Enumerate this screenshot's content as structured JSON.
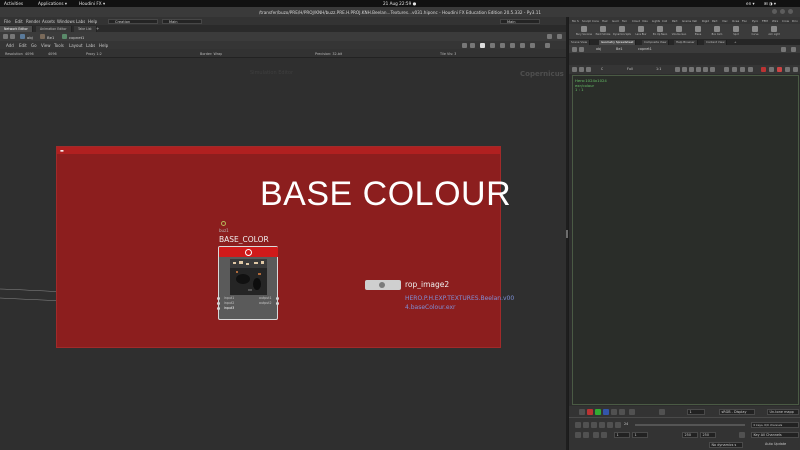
{
  "os_bar": {
    "activities": "Activities",
    "applications": "Applications ▾",
    "app_name": "Houdini FX ▾",
    "clock": "21 Aug  22:59 ●",
    "language": "en ▾",
    "system_icons": "⊞ ◑ ▾"
  },
  "window": {
    "title": "/transfer/buzo/PRE/H/PROJ/KNH/buzz.PRE.H.PROJ.KNH.Beelan...Textures...v031.hiponc - Houdini FX Education Edition 20.5.332 - Py3.11"
  },
  "menubar": {
    "items": [
      "File",
      "Edit",
      "Render",
      "Assets",
      "Windows",
      "Labs",
      "Help"
    ],
    "desktop": "Creation",
    "desktop2": "Main",
    "desktop3": "Main"
  },
  "left_tabs": [
    {
      "label": "Network Editor",
      "active": true
    },
    {
      "label": "Animation Editor",
      "active": false
    },
    {
      "label": "Take List",
      "active": false
    }
  ],
  "left_path": {
    "context": "obj",
    "node": "Be1",
    "copnet": "copnet1"
  },
  "network_menu": [
    "Add",
    "Edit",
    "Go",
    "View",
    "Tools",
    "Layout",
    "Labs",
    "Help"
  ],
  "param_row": {
    "resolution_label": "Resolution",
    "resolution_x": "4096",
    "resolution_y": "4096",
    "proxy": "Proxy 1:2",
    "border": "Border: Wrap",
    "precision": "Precision: 32-bit",
    "tile": "Tile Vis: 3"
  },
  "network": {
    "label": "Simulation Editor",
    "context_label": "Copernicus",
    "netbox_title": "BASE COLOUR",
    "node": {
      "path_label": "buz1",
      "name": "BASE_COLOR",
      "inputs": [
        "input1",
        "input2",
        "input3"
      ],
      "outputs": [
        "output1",
        "output2"
      ]
    },
    "rop": {
      "name": "rop_image2",
      "file": "HERO.P.H.EXP.TEXTURES.Beelan.v004.baseColour.exr"
    }
  },
  "right_pane": {
    "shelf_tabs": [
      "Mo S",
      "Sculpt",
      "Cons",
      "Hair",
      "Guid",
      "Terr",
      "Cloud",
      "Volu",
      "Lights",
      "Coll",
      "Part",
      "Grains",
      "Vell",
      "Rigid",
      "Part",
      "Visc",
      "Ocea",
      "Flui",
      "Pyro",
      "FEM",
      "Wire",
      "Crow",
      "Driv"
    ],
    "shelf_tools": [
      "Bury Sonoine",
      "Paint Smoke",
      "Dynamics Sphere",
      "Lens Blur",
      "Pin Up Neon",
      "Volume Gen",
      "Plane",
      "Box Cam",
      "Spot",
      "Curve",
      "Aim Light"
    ],
    "view_tabs": [
      {
        "label": "Scene View",
        "active": false
      },
      {
        "label": "Geometry Spreadsheet",
        "active": true
      },
      {
        "label": "Composite View",
        "active": false
      },
      {
        "label": "Help Browser",
        "active": false
      },
      {
        "label": "Context View",
        "active": false
      }
    ],
    "path": {
      "context": "obj",
      "node": "Be1",
      "copnet": "copnet1"
    },
    "viewer_toolbar": {
      "mode": "C",
      "zoom": "Full",
      "aspect": "1:1"
    },
    "viewport_info": [
      "Hero:1024x1024",
      "exr/colour",
      "1 : 1"
    ],
    "timebar": {
      "frame": "1",
      "start": "1",
      "end": "250",
      "end2": "250",
      "fps": "24",
      "display": "sRGB - Display",
      "tone": "Un-tone mapp",
      "keys_label": "0 keys, 0/0 channels",
      "key_all": "Key All Channels",
      "dynamics": "No dynamics s",
      "auto_update": "Auto Update"
    }
  }
}
